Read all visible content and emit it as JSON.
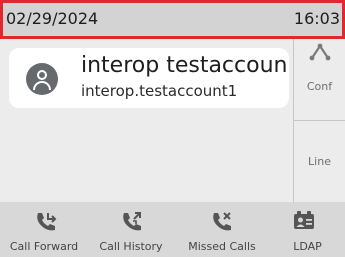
{
  "status_bar": {
    "date": "02/29/2024",
    "time": "16:03"
  },
  "account": {
    "display_name": "interop testaccoun",
    "account_id": "interop.testaccount1",
    "avatar_icon": "person-icon"
  },
  "side_buttons": [
    {
      "label": "Conf",
      "icon": "conference-icon"
    },
    {
      "label": "Line"
    }
  ],
  "soft_keys": [
    {
      "label": "Call Forward",
      "icon": "call-forward-icon"
    },
    {
      "label": "Call History",
      "icon": "call-history-icon"
    },
    {
      "label": "Missed Calls",
      "icon": "missed-calls-icon"
    },
    {
      "label": "LDAP",
      "icon": "directory-icon"
    }
  ],
  "colors": {
    "status_outline": "#e0282f",
    "icon": "#555555"
  }
}
